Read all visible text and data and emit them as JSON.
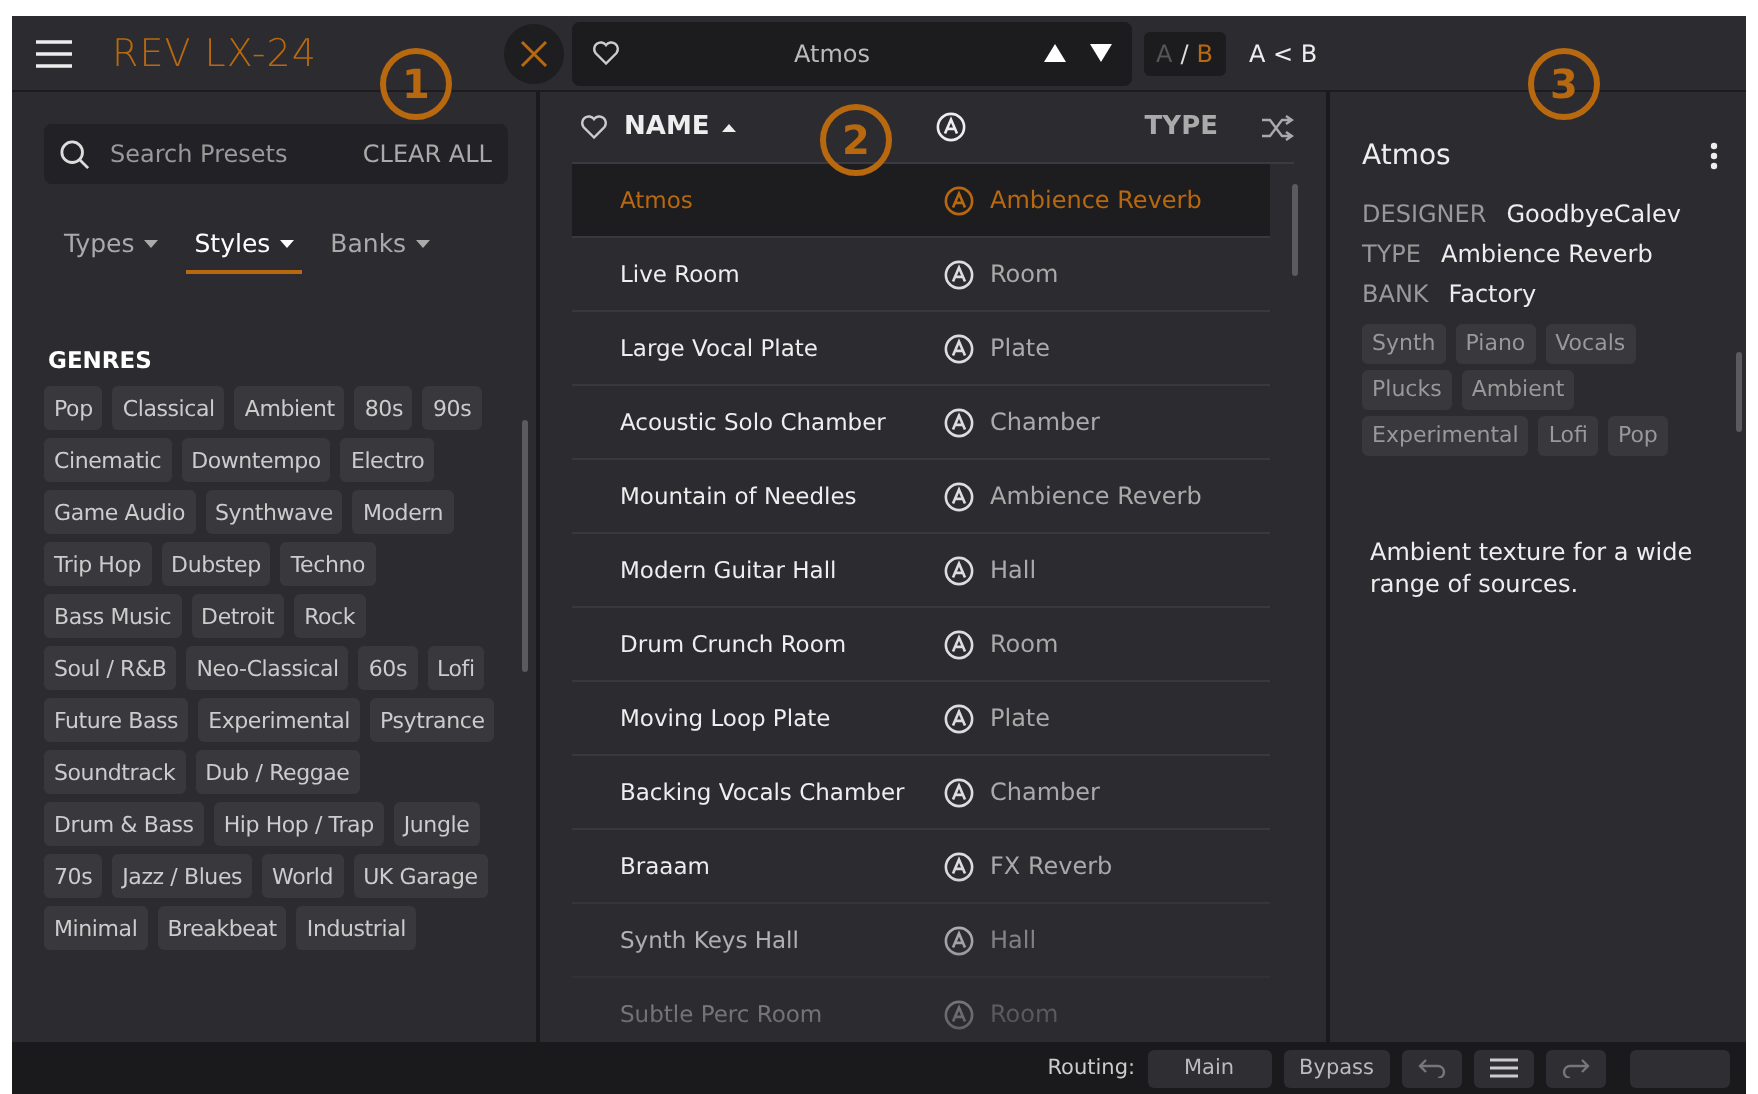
{
  "header": {
    "title": "REV LX-24",
    "preset": "Atmos",
    "ab": {
      "options": [
        {
          "label": "A",
          "selected": false
        },
        {
          "label": "B",
          "selected": true
        }
      ],
      "separator": "/"
    },
    "copy": "A < B"
  },
  "callouts": [
    "1",
    "2",
    "3"
  ],
  "browser": {
    "search": {
      "placeholder": "Search Presets"
    },
    "clear": "CLEAR ALL",
    "tabs": [
      {
        "label": "Types",
        "selected": false
      },
      {
        "label": "Styles",
        "selected": true
      },
      {
        "label": "Banks",
        "selected": false
      }
    ],
    "section": "GENRES",
    "genres": [
      "Pop",
      "Classical",
      "Ambient",
      "80s",
      "90s",
      "Cinematic",
      "Downtempo",
      "Electro",
      "Game Audio",
      "Synthwave",
      "Modern",
      "Trip Hop",
      "Dubstep",
      "Techno",
      "Bass Music",
      "Detroit",
      "Rock",
      "Soul / R&B",
      "Neo-Classical",
      "60s",
      "Lofi",
      "Future Bass",
      "Experimental",
      "Psytrance",
      "Soundtrack",
      "Dub / Reggae",
      "Drum & Bass",
      "Hip Hop / Trap",
      "Jungle",
      "70s",
      "Jazz / Blues",
      "World",
      "UK Garage",
      "Minimal",
      "Breakbeat",
      "Industrial"
    ]
  },
  "list": {
    "columns": [
      "NAME",
      "TYPE"
    ],
    "rows": [
      {
        "name": "Atmos",
        "type": "Ambience Reverb",
        "selected": true
      },
      {
        "name": "Live Room",
        "type": "Room",
        "selected": false
      },
      {
        "name": "Large Vocal Plate",
        "type": "Plate",
        "selected": false
      },
      {
        "name": "Acoustic Solo Chamber",
        "type": "Chamber",
        "selected": false
      },
      {
        "name": "Mountain of Needles",
        "type": "Ambience Reverb",
        "selected": false
      },
      {
        "name": "Modern Guitar Hall",
        "type": "Hall",
        "selected": false
      },
      {
        "name": "Drum Crunch Room",
        "type": "Room",
        "selected": false
      },
      {
        "name": "Moving Loop Plate",
        "type": "Plate",
        "selected": false
      },
      {
        "name": "Backing Vocals Chamber",
        "type": "Chamber",
        "selected": false
      },
      {
        "name": "Braaam",
        "type": "FX Reverb",
        "selected": false
      },
      {
        "name": "Synth Keys Hall",
        "type": "Hall",
        "selected": false
      },
      {
        "name": "Subtle Perc Room",
        "type": "Room",
        "selected": false
      }
    ]
  },
  "details": {
    "name": "Atmos",
    "fields": [
      {
        "label": "DESIGNER",
        "value": "GoodbyeCalev"
      },
      {
        "label": "TYPE",
        "value": "Ambience Reverb"
      },
      {
        "label": "BANK",
        "value": "Factory"
      }
    ],
    "tags": [
      "Synth",
      "Piano",
      "Vocals",
      "Plucks",
      "Ambient",
      "Experimental",
      "Lofi",
      "Pop"
    ],
    "description": "Ambient texture for a wide range of sources."
  },
  "footer": {
    "routing_label": "Routing:",
    "routing": "Main",
    "bypass": "Bypass"
  }
}
